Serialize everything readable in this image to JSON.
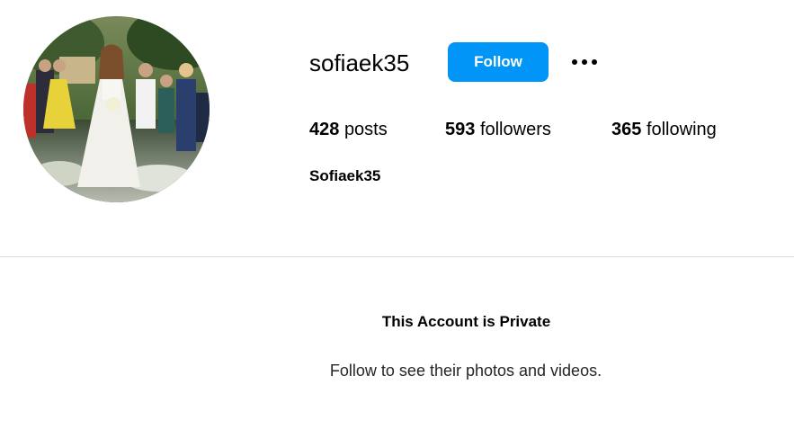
{
  "profile": {
    "username": "sofiaek35",
    "display_name": "Sofiaek35",
    "follow_label": "Follow",
    "more_icon": "more-horizontal-icon",
    "avatar_icon": "profile-picture"
  },
  "stats": {
    "posts_count": "428",
    "posts_label": "posts",
    "followers_count": "593",
    "followers_label": "followers",
    "following_count": "365",
    "following_label": "following"
  },
  "private_notice": {
    "title": "This Account is Private",
    "message": "Follow to see their photos and videos."
  },
  "colors": {
    "accent": "#0095f6",
    "divider": "#dbdbdb",
    "text": "#000000"
  }
}
